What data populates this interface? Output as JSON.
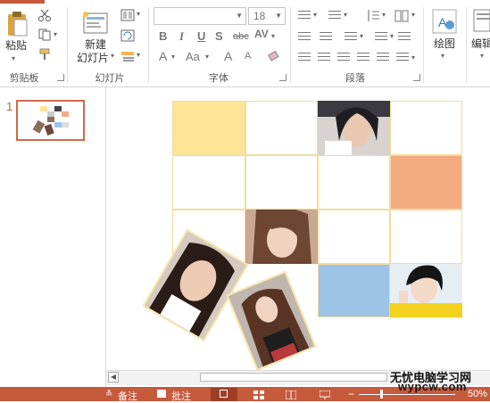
{
  "ribbon": {
    "clipboard": {
      "paste_label": "粘贴",
      "group_label": "剪贴板"
    },
    "slides": {
      "new_slide_label_line1": "新建",
      "new_slide_label_line2": "幻灯片",
      "group_label": "幻灯片"
    },
    "font": {
      "font_name": "",
      "font_size": "18",
      "bold": "B",
      "italic": "I",
      "underline": "U",
      "shadow": "S",
      "strike": "abc",
      "spacing": "AV",
      "font_color": "A",
      "change_case": "Aa",
      "grow": "A",
      "shrink": "A",
      "group_label": "字体"
    },
    "paragraph": {
      "group_label": "段落"
    },
    "drawing": {
      "label": "绘图"
    },
    "editing": {
      "label": "编辑"
    }
  },
  "slides_pane": {
    "slide_number": "1"
  },
  "statusbar": {
    "notes_label": "备注",
    "comments_label": "批注",
    "zoom": "50%"
  },
  "watermark": {
    "line1": "无忧电脑学习网",
    "line2": "wypcw.com"
  },
  "colors": {
    "accent": "#c55a3c",
    "cell_yellow": "#fde597",
    "cell_orange": "#f3aa80",
    "cell_blue": "#9dc3e6",
    "cell_border": "#f2dc9a"
  }
}
